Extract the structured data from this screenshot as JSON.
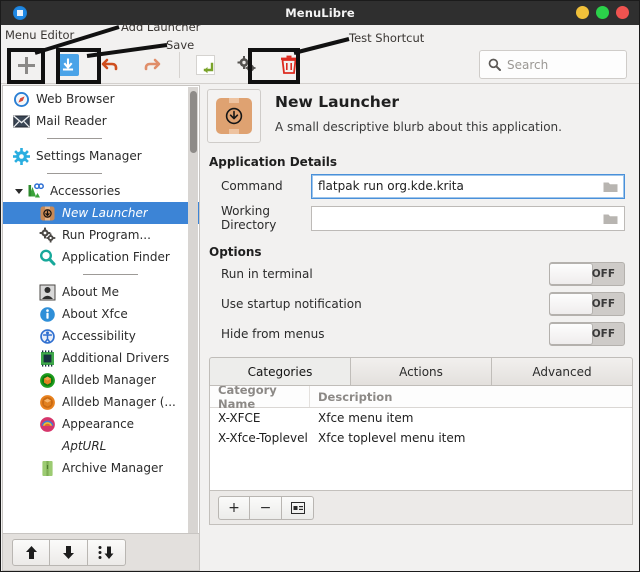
{
  "window": {
    "title": "MenuLibre",
    "app_icon": "menulibre-icon",
    "buttons": {
      "minimize": "minimize-button",
      "maximize": "maximize-button",
      "close": "close-button"
    }
  },
  "annotations": [
    {
      "id": "menu-editor",
      "text": "Menu Editor"
    },
    {
      "id": "add-launcher",
      "text": "Add Launcher"
    },
    {
      "id": "save",
      "text": "Save"
    },
    {
      "id": "test-shortcut",
      "text": "Test Shortcut"
    }
  ],
  "toolbar": {
    "add_launcher_label": "Add Launcher",
    "save_label": "Save",
    "undo_label": "Undo",
    "redo_label": "Redo",
    "revert_label": "Revert",
    "test_shortcut_label": "Test Shortcut",
    "delete_label": "Delete",
    "icons": [
      "plus-icon",
      "save-icon",
      "undo-icon",
      "redo-icon",
      "revert-icon",
      "gears-icon",
      "trash-icon"
    ]
  },
  "search": {
    "placeholder": "Search",
    "value": "",
    "icon": "search-icon"
  },
  "sidebar": {
    "items": [
      {
        "type": "item",
        "label": "Web Browser",
        "icon": "compass-icon",
        "indent": "top"
      },
      {
        "type": "item",
        "label": "Mail Reader",
        "icon": "envelope-icon",
        "indent": "top"
      },
      {
        "type": "sep",
        "label": "",
        "icon": "",
        "indent": "top"
      },
      {
        "type": "item",
        "label": "Settings Manager",
        "icon": "gear-icon",
        "indent": "top"
      },
      {
        "type": "sep",
        "label": "",
        "icon": "",
        "indent": "top"
      },
      {
        "type": "group",
        "label": "Accessories",
        "icon": "accessories-icon",
        "indent": "top"
      },
      {
        "type": "item",
        "label": "New Launcher",
        "icon": "package-icon",
        "indent": "child",
        "selected": true
      },
      {
        "type": "item",
        "label": "Run Program...",
        "icon": "gears-icon",
        "indent": "child"
      },
      {
        "type": "item",
        "label": "Application Finder",
        "icon": "magnifier-icon",
        "indent": "child"
      },
      {
        "type": "sep",
        "label": "",
        "icon": "",
        "indent": "child"
      },
      {
        "type": "item",
        "label": "About Me",
        "icon": "user-icon",
        "indent": "child"
      },
      {
        "type": "item",
        "label": "About Xfce",
        "icon": "info-icon",
        "indent": "child"
      },
      {
        "type": "item",
        "label": "Accessibility",
        "icon": "accessibility-icon",
        "indent": "child"
      },
      {
        "type": "item",
        "label": "Additional Drivers",
        "icon": "chip-icon",
        "indent": "child"
      },
      {
        "type": "item",
        "label": "Alldeb Manager",
        "icon": "green-box-icon",
        "indent": "child"
      },
      {
        "type": "item",
        "label": "Alldeb Manager (...",
        "icon": "orange-box-icon",
        "indent": "child"
      },
      {
        "type": "item",
        "label": "Appearance",
        "icon": "appearance-icon",
        "indent": "child"
      },
      {
        "type": "item",
        "label": "AptURL",
        "icon": "",
        "indent": "child",
        "no_icon": true
      },
      {
        "type": "item",
        "label": "Archive Manager",
        "icon": "archive-icon",
        "indent": "child"
      }
    ],
    "footer_buttons": [
      {
        "name": "move-up-button",
        "icon": "arrow-up-icon"
      },
      {
        "name": "move-down-button",
        "icon": "arrow-down-icon"
      },
      {
        "name": "move-to-button",
        "icon": "move-to-icon"
      }
    ]
  },
  "main": {
    "launcher_icon": "package-download-icon",
    "title": "New Launcher",
    "subtitle": "A small descriptive blurb about this application.",
    "details_heading": "Application Details",
    "fields": [
      {
        "label": "Command",
        "value": "flatpak run org.kde.krita",
        "focused": true
      },
      {
        "label": "Working Directory",
        "value": "",
        "focused": false
      }
    ],
    "options_heading": "Options",
    "options": [
      {
        "label": "Run in terminal",
        "state": "OFF"
      },
      {
        "label": "Use startup notification",
        "state": "OFF"
      },
      {
        "label": "Hide from menus",
        "state": "OFF"
      }
    ],
    "tabs": [
      {
        "label": "Categories",
        "active": true
      },
      {
        "label": "Actions",
        "active": false
      },
      {
        "label": "Advanced",
        "active": false
      }
    ],
    "table": {
      "headers": [
        "Category Name",
        "Description"
      ],
      "rows": [
        [
          "X-XFCE",
          "Xfce menu item"
        ],
        [
          "X-Xfce-Toplevel",
          "Xfce toplevel menu item"
        ]
      ]
    },
    "table_actions": [
      {
        "name": "add-category-button",
        "label": "+"
      },
      {
        "name": "remove-category-button",
        "label": "−"
      },
      {
        "name": "edit-category-button",
        "label": ""
      }
    ]
  },
  "colors": {
    "selection": "#3c84d6",
    "accent_save": "#4aa3e8",
    "delete": "#d93025",
    "undo": "#d4582a",
    "window_bg": "#f2f1f0",
    "titlebar": "#2f2f2f"
  }
}
